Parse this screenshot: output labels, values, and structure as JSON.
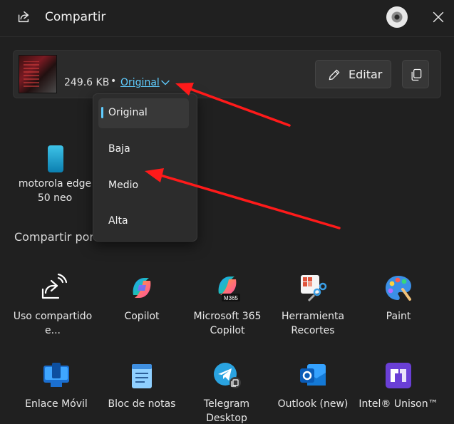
{
  "header": {
    "title": "Compartir",
    "close_icon": "close-icon",
    "share_icon": "share-icon"
  },
  "file": {
    "size": "249.6 KB",
    "separator": "•",
    "quality_selected": "Original",
    "edit_label": "Editar",
    "copy_icon": "copy-icon"
  },
  "quality_menu": {
    "options": [
      "Original",
      "Baja",
      "Medio",
      "Alta"
    ],
    "selected": "Original"
  },
  "nearby_device": {
    "label": "motorola edge 50 neo"
  },
  "share_section": {
    "title": "Compartir por"
  },
  "apps": [
    {
      "label": "Uso compartido e...",
      "icon": "nearby-share-icon"
    },
    {
      "label": "Copilot",
      "icon": "copilot-icon"
    },
    {
      "label": "Microsoft 365 Copilot",
      "icon": "m365-copilot-icon"
    },
    {
      "label": "Herramienta Recortes",
      "icon": "snipping-tool-icon"
    },
    {
      "label": "Paint",
      "icon": "paint-icon"
    },
    {
      "label": "Enlace Móvil",
      "icon": "phone-link-icon"
    },
    {
      "label": "Bloc de notas",
      "icon": "notepad-icon"
    },
    {
      "label": "Telegram Desktop",
      "icon": "telegram-icon"
    },
    {
      "label": "Outlook (new)",
      "icon": "outlook-icon"
    },
    {
      "label": "Intel® Unison™",
      "icon": "intel-unison-icon"
    }
  ],
  "colors": {
    "accent": "#60cdff",
    "background": "#202020",
    "annotation_arrow": "#ff1a1a"
  }
}
